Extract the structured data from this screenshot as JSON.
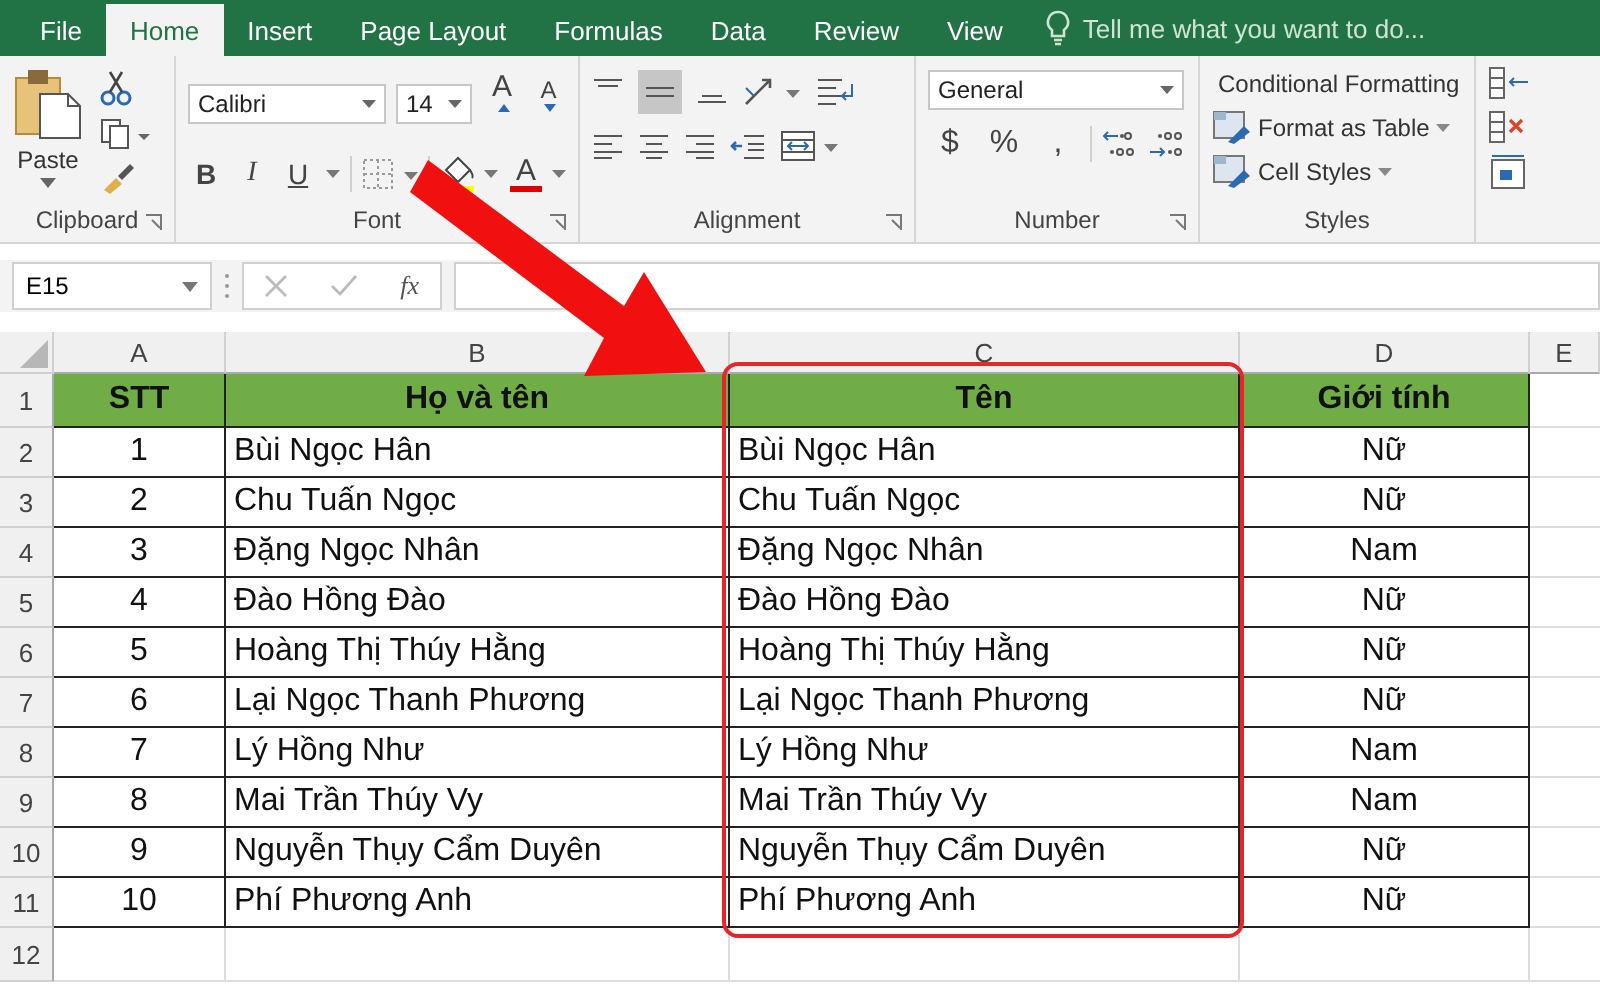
{
  "tabs": [
    {
      "label": "File",
      "selected": false
    },
    {
      "label": "Home",
      "selected": true
    },
    {
      "label": "Insert",
      "selected": false
    },
    {
      "label": "Page Layout",
      "selected": false
    },
    {
      "label": "Formulas",
      "selected": false
    },
    {
      "label": "Data",
      "selected": false
    },
    {
      "label": "Review",
      "selected": false
    },
    {
      "label": "View",
      "selected": false
    }
  ],
  "tell_me": {
    "placeholder": "Tell me what you want to do..."
  },
  "ribbon": {
    "clipboard": {
      "paste": "Paste",
      "group": "Clipboard"
    },
    "font": {
      "name": "Calibri",
      "size": "14",
      "grow": "A",
      "shrink": "A",
      "styles": [
        "B",
        "I",
        "U"
      ],
      "font_color": "A",
      "group": "Font"
    },
    "alignment": {
      "group": "Alignment"
    },
    "number": {
      "format": "General",
      "symbols": [
        "$",
        "%",
        ","
      ],
      "group": "Number"
    },
    "styles": {
      "items": [
        "Conditional Formatting",
        "Format as Table",
        "Cell Styles"
      ],
      "group": "Styles"
    }
  },
  "formula_bar": {
    "name_box": "E15",
    "fx": "fx"
  },
  "sheet": {
    "columns": [
      "A",
      "B",
      "C",
      "D",
      "E"
    ],
    "rows": [
      {
        "number": "1",
        "kind": "header",
        "cells": [
          "STT",
          "Họ và tên",
          "Tên",
          "Giới tính"
        ]
      },
      {
        "number": "2",
        "kind": "data",
        "cells": [
          "1",
          "Bùi Ngọc Hân",
          "Bùi Ngọc Hân",
          "Nữ"
        ]
      },
      {
        "number": "3",
        "kind": "data",
        "cells": [
          "2",
          "Chu Tuấn Ngọc",
          "Chu Tuấn Ngọc",
          "Nữ"
        ]
      },
      {
        "number": "4",
        "kind": "data",
        "cells": [
          "3",
          "Đặng Ngọc Nhân",
          "Đặng Ngọc Nhân",
          "Nam"
        ]
      },
      {
        "number": "5",
        "kind": "data",
        "cells": [
          "4",
          "Đào Hồng Đào",
          "Đào Hồng Đào",
          "Nữ"
        ]
      },
      {
        "number": "6",
        "kind": "data",
        "cells": [
          "5",
          "Hoàng Thị Thúy Hằng",
          "Hoàng Thị Thúy Hằng",
          "Nữ"
        ]
      },
      {
        "number": "7",
        "kind": "data",
        "cells": [
          "6",
          "Lại Ngọc Thanh Phương",
          "Lại Ngọc Thanh Phương",
          "Nữ"
        ]
      },
      {
        "number": "8",
        "kind": "data",
        "cells": [
          "7",
          "Lý Hồng Như",
          "Lý Hồng Như",
          "Nam"
        ]
      },
      {
        "number": "9",
        "kind": "data",
        "cells": [
          "8",
          "Mai Trần Thúy Vy",
          "Mai Trần Thúy Vy",
          "Nam"
        ]
      },
      {
        "number": "10",
        "kind": "data",
        "cells": [
          "9",
          "Nguyễn Thụy Cẩm Duyên",
          "Nguyễn Thụy Cẩm Duyên",
          "Nữ"
        ]
      },
      {
        "number": "11",
        "kind": "data",
        "cells": [
          "10",
          "Phí Phương Anh",
          "Phí Phương Anh",
          "Nữ"
        ]
      },
      {
        "number": "12",
        "kind": "data"
      }
    ]
  }
}
